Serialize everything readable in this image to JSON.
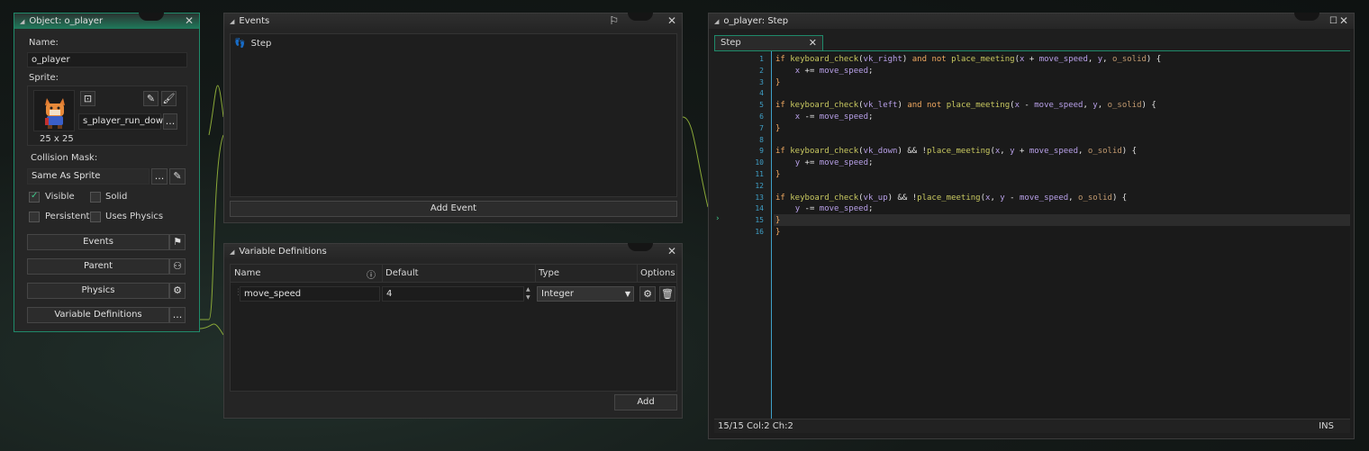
{
  "object_panel": {
    "title": "Object: o_player",
    "name_label": "Name:",
    "name_value": "o_player",
    "sprite_label": "Sprite:",
    "sprite_size": "25 x 25",
    "sprite_name": "s_player_run_down",
    "collision_label": "Collision Mask:",
    "collision_value": "Same As Sprite",
    "checks": [
      {
        "label": "Visible",
        "checked": true
      },
      {
        "label": "Solid",
        "checked": false
      },
      {
        "label": "Persistent",
        "checked": false
      },
      {
        "label": "Uses Physics",
        "checked": false
      }
    ],
    "buttons": [
      "Events",
      "Parent",
      "Physics",
      "Variable Definitions"
    ],
    "more_label": "..."
  },
  "events_panel": {
    "title": "Events",
    "events": [
      "Step"
    ],
    "add_label": "Add Event"
  },
  "vars_panel": {
    "title": "Variable Definitions",
    "columns": [
      "Name",
      "Default",
      "Type",
      "Options"
    ],
    "rows": [
      {
        "name": "move_speed",
        "default": "4",
        "type": "Integer"
      }
    ],
    "add_label": "Add"
  },
  "code_panel": {
    "title": "o_player: Step",
    "tab": "Step",
    "status": "15/15 Col:2 Ch:2",
    "mode": "INS",
    "lines": [
      "if keyboard_check(vk_right) and not place_meeting(x + move_speed, y, o_solid) {",
      "    x += move_speed;",
      "}",
      "",
      "if keyboard_check(vk_left) and not place_meeting(x - move_speed, y, o_solid) {",
      "    x -= move_speed;",
      "}",
      "",
      "if keyboard_check(vk_down) && !place_meeting(x, y + move_speed, o_solid) {",
      "    y += move_speed;",
      "}",
      "",
      "if keyboard_check(vk_up) && !place_meeting(x, y - move_speed, o_solid) {",
      "    y -= move_speed;",
      "}"
    ]
  }
}
